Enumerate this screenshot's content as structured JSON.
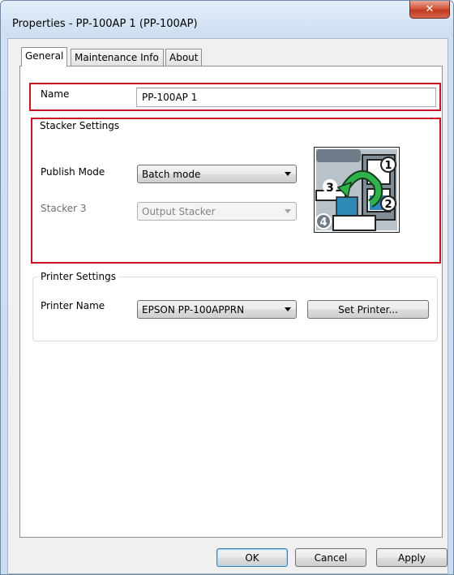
{
  "window": {
    "title": "Properties - PP-100AP 1 (PP-100AP)",
    "close_glyph": "✕"
  },
  "tabs": [
    {
      "label": "General",
      "active": true
    },
    {
      "label": "Maintenance Info",
      "active": false
    },
    {
      "label": "About",
      "active": false
    }
  ],
  "name": {
    "label": "Name",
    "value": "PP-100AP 1"
  },
  "stacker_settings": {
    "title": "Stacker Settings",
    "publish_mode": {
      "label": "Publish Mode",
      "value": "Batch mode"
    },
    "stacker3": {
      "label": "Stacker 3",
      "value": "Output Stacker",
      "disabled": true
    },
    "diagram_numbers": [
      "1",
      "2",
      "3",
      "4"
    ]
  },
  "printer_settings": {
    "title": "Printer Settings",
    "printer_name": {
      "label": "Printer Name",
      "value": "EPSON PP-100APPRN"
    },
    "set_printer_label": "Set Printer..."
  },
  "buttons": {
    "ok": "OK",
    "cancel": "Cancel",
    "apply": "Apply"
  },
  "colors": {
    "highlight_border": "#c8141e",
    "close_button": "#c0391f",
    "arrow_green": "#2fb24a"
  }
}
